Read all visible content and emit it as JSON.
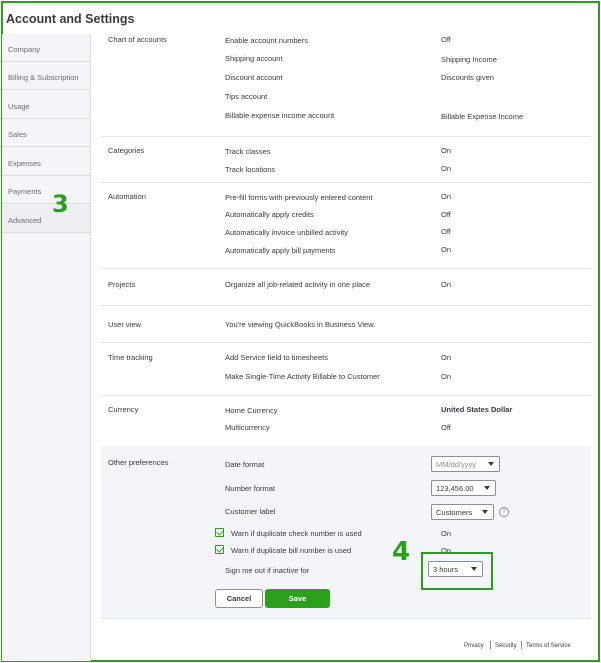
{
  "page_title": "Account and Settings",
  "sidebar": {
    "items": [
      {
        "label": "Company"
      },
      {
        "label": "Billing & Subscription"
      },
      {
        "label": "Usage"
      },
      {
        "label": "Sales"
      },
      {
        "label": "Expenses"
      },
      {
        "label": "Payments"
      },
      {
        "label": "Advanced"
      }
    ],
    "marker": "3"
  },
  "sections": {
    "chart_of_accounts": {
      "title": "Chart of accounts",
      "rows": [
        {
          "label": "Enable account numbers",
          "value": "Off"
        },
        {
          "label": "Shipping account",
          "value": "Shipping Income"
        },
        {
          "label": "Discount account",
          "value": "Discounts given"
        },
        {
          "label": "Tips account",
          "value": ""
        },
        {
          "label": "Billable expense income account",
          "value": "Billable Expense Income"
        }
      ]
    },
    "categories": {
      "title": "Categories",
      "rows": [
        {
          "label": "Track classes",
          "value": "On"
        },
        {
          "label": "Track locations",
          "value": "On"
        }
      ]
    },
    "automation": {
      "title": "Automation",
      "rows": [
        {
          "label": "Pre-fill forms with previously entered content",
          "value": "On"
        },
        {
          "label": "Automatically apply credits",
          "value": "Off"
        },
        {
          "label": "Automatically invoice unbilled activity",
          "value": "Off"
        },
        {
          "label": "Automatically apply bill payments",
          "value": "On"
        }
      ]
    },
    "projects": {
      "title": "Projects",
      "rows": [
        {
          "label": "Organize all job-related activity in one place",
          "value": "On"
        }
      ]
    },
    "user_view": {
      "title": "User view",
      "rows": [
        {
          "label": "You're viewing QuickBooks in Business View.",
          "value": ""
        }
      ]
    },
    "time_tracking": {
      "title": "Time tracking",
      "rows": [
        {
          "label": "Add Service field to timesheets",
          "value": "On"
        },
        {
          "label": "Make Single-Time Activity Billable to Customer",
          "value": "On"
        }
      ]
    },
    "currency": {
      "title": "Currency",
      "rows": [
        {
          "label": "Home Currency",
          "value": "United States Dollar"
        },
        {
          "label": "Multicurrency",
          "value": "Off"
        }
      ]
    },
    "other_preferences": {
      "title": "Other preferences",
      "date_format": {
        "label": "Date format",
        "placeholder": "MM/dd/yyyy"
      },
      "number_format": {
        "label": "Number format",
        "value": "123,456.00"
      },
      "customer_label": {
        "label": "Customer label",
        "value": "Customers",
        "help": "?"
      },
      "warn_check": {
        "label": "Warn if duplicate check number is used",
        "value": "On",
        "checked": true
      },
      "warn_bill": {
        "label": "Warn if duplicate bill number is used",
        "value": "On",
        "checked": true
      },
      "signout": {
        "label": "Sign me out if inactive for",
        "value": "3 hours"
      },
      "cancel_label": "Cancel",
      "save_label": "Save",
      "marker": "4"
    }
  },
  "footer": {
    "privacy": "Privacy",
    "security": "Security",
    "terms": "Terms of Service"
  },
  "colors": {
    "accent": "#2ca01c",
    "text": "#393a3d",
    "sidebar_bg": "#f4f5f8"
  }
}
